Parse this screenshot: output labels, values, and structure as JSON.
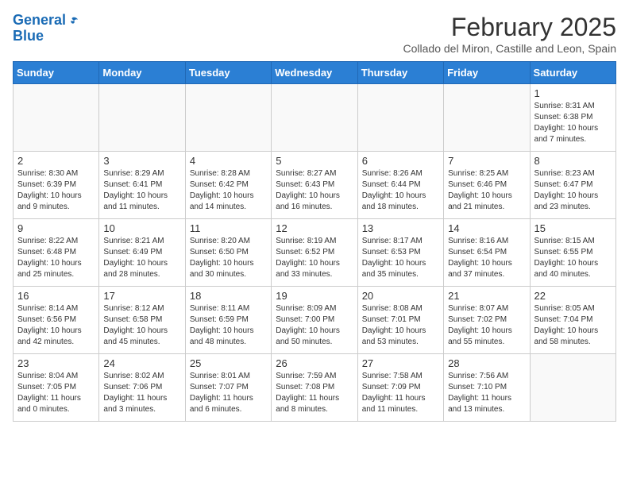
{
  "header": {
    "logo_line1": "General",
    "logo_line2": "Blue",
    "month": "February 2025",
    "location": "Collado del Miron, Castille and Leon, Spain"
  },
  "weekdays": [
    "Sunday",
    "Monday",
    "Tuesday",
    "Wednesday",
    "Thursday",
    "Friday",
    "Saturday"
  ],
  "weeks": [
    [
      {
        "day": "",
        "info": ""
      },
      {
        "day": "",
        "info": ""
      },
      {
        "day": "",
        "info": ""
      },
      {
        "day": "",
        "info": ""
      },
      {
        "day": "",
        "info": ""
      },
      {
        "day": "",
        "info": ""
      },
      {
        "day": "1",
        "info": "Sunrise: 8:31 AM\nSunset: 6:38 PM\nDaylight: 10 hours\nand 7 minutes."
      }
    ],
    [
      {
        "day": "2",
        "info": "Sunrise: 8:30 AM\nSunset: 6:39 PM\nDaylight: 10 hours\nand 9 minutes."
      },
      {
        "day": "3",
        "info": "Sunrise: 8:29 AM\nSunset: 6:41 PM\nDaylight: 10 hours\nand 11 minutes."
      },
      {
        "day": "4",
        "info": "Sunrise: 8:28 AM\nSunset: 6:42 PM\nDaylight: 10 hours\nand 14 minutes."
      },
      {
        "day": "5",
        "info": "Sunrise: 8:27 AM\nSunset: 6:43 PM\nDaylight: 10 hours\nand 16 minutes."
      },
      {
        "day": "6",
        "info": "Sunrise: 8:26 AM\nSunset: 6:44 PM\nDaylight: 10 hours\nand 18 minutes."
      },
      {
        "day": "7",
        "info": "Sunrise: 8:25 AM\nSunset: 6:46 PM\nDaylight: 10 hours\nand 21 minutes."
      },
      {
        "day": "8",
        "info": "Sunrise: 8:23 AM\nSunset: 6:47 PM\nDaylight: 10 hours\nand 23 minutes."
      }
    ],
    [
      {
        "day": "9",
        "info": "Sunrise: 8:22 AM\nSunset: 6:48 PM\nDaylight: 10 hours\nand 25 minutes."
      },
      {
        "day": "10",
        "info": "Sunrise: 8:21 AM\nSunset: 6:49 PM\nDaylight: 10 hours\nand 28 minutes."
      },
      {
        "day": "11",
        "info": "Sunrise: 8:20 AM\nSunset: 6:50 PM\nDaylight: 10 hours\nand 30 minutes."
      },
      {
        "day": "12",
        "info": "Sunrise: 8:19 AM\nSunset: 6:52 PM\nDaylight: 10 hours\nand 33 minutes."
      },
      {
        "day": "13",
        "info": "Sunrise: 8:17 AM\nSunset: 6:53 PM\nDaylight: 10 hours\nand 35 minutes."
      },
      {
        "day": "14",
        "info": "Sunrise: 8:16 AM\nSunset: 6:54 PM\nDaylight: 10 hours\nand 37 minutes."
      },
      {
        "day": "15",
        "info": "Sunrise: 8:15 AM\nSunset: 6:55 PM\nDaylight: 10 hours\nand 40 minutes."
      }
    ],
    [
      {
        "day": "16",
        "info": "Sunrise: 8:14 AM\nSunset: 6:56 PM\nDaylight: 10 hours\nand 42 minutes."
      },
      {
        "day": "17",
        "info": "Sunrise: 8:12 AM\nSunset: 6:58 PM\nDaylight: 10 hours\nand 45 minutes."
      },
      {
        "day": "18",
        "info": "Sunrise: 8:11 AM\nSunset: 6:59 PM\nDaylight: 10 hours\nand 48 minutes."
      },
      {
        "day": "19",
        "info": "Sunrise: 8:09 AM\nSunset: 7:00 PM\nDaylight: 10 hours\nand 50 minutes."
      },
      {
        "day": "20",
        "info": "Sunrise: 8:08 AM\nSunset: 7:01 PM\nDaylight: 10 hours\nand 53 minutes."
      },
      {
        "day": "21",
        "info": "Sunrise: 8:07 AM\nSunset: 7:02 PM\nDaylight: 10 hours\nand 55 minutes."
      },
      {
        "day": "22",
        "info": "Sunrise: 8:05 AM\nSunset: 7:04 PM\nDaylight: 10 hours\nand 58 minutes."
      }
    ],
    [
      {
        "day": "23",
        "info": "Sunrise: 8:04 AM\nSunset: 7:05 PM\nDaylight: 11 hours\nand 0 minutes."
      },
      {
        "day": "24",
        "info": "Sunrise: 8:02 AM\nSunset: 7:06 PM\nDaylight: 11 hours\nand 3 minutes."
      },
      {
        "day": "25",
        "info": "Sunrise: 8:01 AM\nSunset: 7:07 PM\nDaylight: 11 hours\nand 6 minutes."
      },
      {
        "day": "26",
        "info": "Sunrise: 7:59 AM\nSunset: 7:08 PM\nDaylight: 11 hours\nand 8 minutes."
      },
      {
        "day": "27",
        "info": "Sunrise: 7:58 AM\nSunset: 7:09 PM\nDaylight: 11 hours\nand 11 minutes."
      },
      {
        "day": "28",
        "info": "Sunrise: 7:56 AM\nSunset: 7:10 PM\nDaylight: 11 hours\nand 13 minutes."
      },
      {
        "day": "",
        "info": ""
      }
    ]
  ]
}
